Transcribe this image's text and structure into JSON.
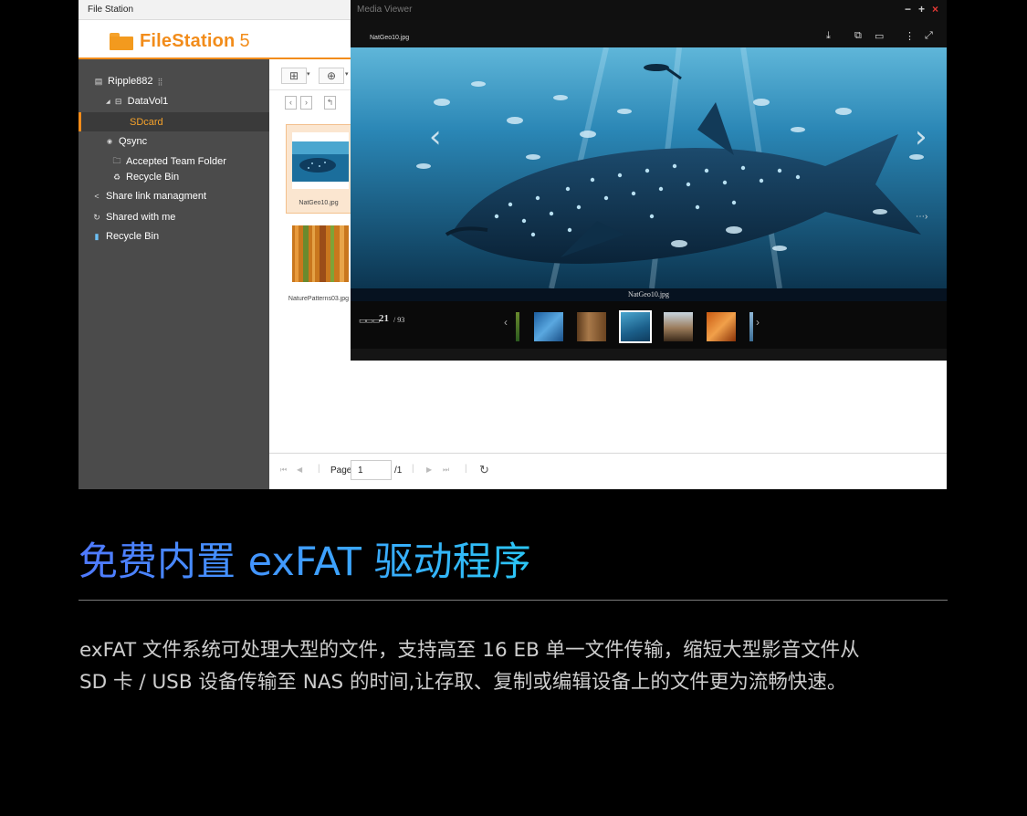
{
  "file_station": {
    "title": "File Station",
    "logo_text": "FileStation",
    "logo_version": "5",
    "sidebar": {
      "nas_name": "Ripple882",
      "volume": "DataVol1",
      "selected_folder": "SDcard",
      "qsync": "Qsync",
      "team_folder": "Accepted Team Folder",
      "qsync_recycle": "Recycle Bin",
      "share_link": "Share link managment",
      "shared_with_me": "Shared with me",
      "recycle_bin": "Recycle Bin"
    },
    "files": [
      {
        "name": "NatGeo10.jpg",
        "selected": true
      },
      {
        "name": "NaturePatterns03.jpg",
        "selected": false
      }
    ],
    "pager": {
      "label": "Page",
      "current": "1",
      "total": "/1"
    }
  },
  "media_viewer": {
    "title": "Media Viewer",
    "filename": "NatGeo10.jpg",
    "caption": "NatGeo10.jpg",
    "counter": "21",
    "counter_total": "/ 93"
  },
  "colors": {
    "accent": "#f28c1a",
    "sidebar": "#4b4b4b",
    "headline_gradient": [
      "#4f79ff",
      "#2bc6f5"
    ],
    "close": "#e53935"
  },
  "headline": "免费内置 exFAT 驱动程序",
  "description": [
    "exFAT 文件系统可处理大型的文件，支持高至 16 EB 单一文件传输，缩短大型影音文件从",
    "SD 卡 / USB 设备传输至 NAS 的时间,让存取、复制或编辑设备上的文件更为流畅快速。"
  ]
}
